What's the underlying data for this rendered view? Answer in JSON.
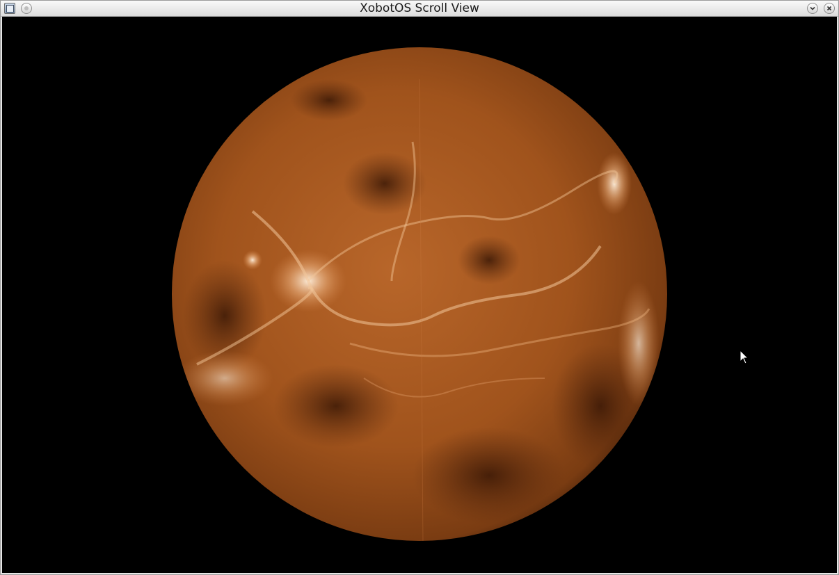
{
  "window": {
    "title": "XobotOS Scroll View"
  },
  "titlebar": {
    "window_menu_icon": "window-menu-icon",
    "shade_icon": "shade-icon",
    "minimize_icon": "chevron-down-icon",
    "close_icon": "close-icon"
  },
  "content": {
    "image_subject": "planet",
    "colors": {
      "background": "#000000",
      "planet_dark": "#5a2a0e",
      "planet_mid": "#a4571f",
      "planet_light": "#f3c79a"
    }
  },
  "pointer": {
    "icon": "mouse-cursor-icon"
  }
}
